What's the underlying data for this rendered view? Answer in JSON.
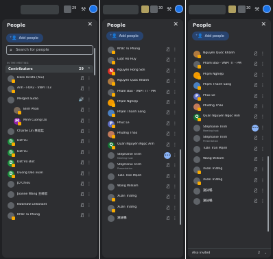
{
  "topbar": {
    "meeting_count": "29",
    "meeting_count_2": "30",
    "meeting_count_3": "30"
  },
  "panel": {
    "title": "People",
    "close_glyph": "✕",
    "add_label": "Add people",
    "add_icon": "person-add-icon",
    "search_placeholder": "Search for people",
    "in_meeting": "IN THE MEETING",
    "contributors": "Contributors",
    "contributors_count": "29",
    "also_invited": "Also invited",
    "also_invited_count": "2"
  },
  "glyphs": {
    "mic_off": "🎙̸",
    "more": "⋮",
    "collapse": "⌃",
    "expand": "⌄",
    "search": "⌕",
    "close": "✕"
  },
  "colors": {
    "accent": "#1a73e8",
    "badge": "#f9ab00",
    "panel": "#2d2e31"
  },
  "col1_rows": [
    {
      "name": "Daiki Hirata (You)",
      "color": "#5f6368",
      "badge": true,
      "mic": "🎙̸"
    },
    {
      "name": "Anh - FOP2 - VNPT IT3",
      "color": "#5f6368",
      "badge": true,
      "mic": "🎙̸"
    },
    {
      "name": "Merged audio",
      "color": "#5f6368",
      "badge": false,
      "mic": "🔊̸"
    },
    {
      "name": "Bình Phan",
      "color": "#7a6a5a",
      "badge": true,
      "mic": "🎙̸",
      "indent": true
    },
    {
      "name": "Minh Cuong Do",
      "color": "#8e24aa",
      "letter": "M",
      "badge": true,
      "mic": "🎙̸",
      "indent": true
    },
    {
      "name": "Charlie Lin 林延廷",
      "color": "#5f6368",
      "badge": false,
      "mic": "🎙̸"
    },
    {
      "name": "Dat Vu",
      "color": "#1e8e3e",
      "letter": "D",
      "badge": true,
      "mic": "🎙̸"
    },
    {
      "name": "Dat Vu",
      "color": "#1e8e3e",
      "letter": "D",
      "badge": true,
      "mic": "🎙̸"
    },
    {
      "name": "Dat Vũ Đức",
      "color": "#1e8e3e",
      "letter": "D",
      "badge": true,
      "mic": "🎙̸"
    },
    {
      "name": "Duong Dao xuan",
      "color": "#1e8e3e",
      "letter": "D",
      "badge": true,
      "mic": "🎙̸"
    },
    {
      "name": "JD Chiou",
      "color": "#5f6368",
      "badge": false,
      "mic": "🎙̸"
    },
    {
      "name": "Joanne Wang 王綺思",
      "color": "#5f6368",
      "badge": false,
      "mic": "🎙̸"
    },
    {
      "name": "Kwanlaw Lewanant",
      "color": "#5f6368",
      "badge": false,
      "mic": "🎙̸"
    },
    {
      "name": "Khắc Tú Phùng",
      "color": "#5f6368",
      "badge": true,
      "mic": "🎙̸"
    }
  ],
  "col2_rows": [
    {
      "name": "Khắc Tú Phùng",
      "color": "#5f6368",
      "badge": true
    },
    {
      "name": "Luật Hồ Huy",
      "color": "#5f6368",
      "badge": true
    },
    {
      "name": "Nguyễn Hồng Sơn",
      "color": "#d93025",
      "letter": "N",
      "badge": true
    },
    {
      "name": "Nguyễn Quốc Khánh",
      "color": "#b07a40",
      "badge": true
    },
    {
      "name": "Pham Bao - VNPT IT - PM",
      "color": "#5f6368",
      "badge": true
    },
    {
      "name": "Phạm Nghiệp",
      "color": "#f29900",
      "badge": true
    },
    {
      "name": "Phạm Thanh Sang",
      "color": "#4a7fc1",
      "badge": true
    },
    {
      "name": "Phuc Le",
      "color": "#5c6bc0",
      "letter": "P",
      "badge": true
    },
    {
      "name": "Phương Thảo",
      "color": "#c27a5a",
      "badge": true
    },
    {
      "name": "Quân Nguyễn Ngọc Anh",
      "color": "#137333",
      "letter": "Q",
      "badge": true
    },
    {
      "name": "Stephanie Trinh",
      "sub": "Meeting host",
      "color": "#5f6368",
      "badge": false,
      "talking": true
    },
    {
      "name": "Stephanie Trinh",
      "sub": "Presentation",
      "color": "#5f6368",
      "badge": false
    },
    {
      "name": "Tuấn Trần Mạnh",
      "color": "#5f6368",
      "badge": false
    },
    {
      "name": "Wang William",
      "color": "#5f6368",
      "badge": false
    },
    {
      "name": "Xuân Trường",
      "color": "#5f6368",
      "badge": true
    },
    {
      "name": "Xuân Trường",
      "color": "#5f6368",
      "badge": true
    },
    {
      "name": "謝詠暢",
      "color": "#5f6368",
      "badge": false
    }
  ],
  "col3_rows": [
    {
      "name": "Nguyễn Quốc Khánh",
      "color": "#b07a40",
      "badge": true
    },
    {
      "name": "Pham Bao - VNPT IT - PM",
      "color": "#5f6368",
      "badge": true
    },
    {
      "name": "Phạm Nghiệp",
      "color": "#f29900",
      "badge": true
    },
    {
      "name": "Phạm Thanh Sang",
      "color": "#4a7fc1",
      "badge": true
    },
    {
      "name": "Phuc Le",
      "color": "#5c6bc0",
      "letter": "P",
      "badge": true
    },
    {
      "name": "Phương Thảo",
      "color": "#c27a5a",
      "badge": true
    },
    {
      "name": "Quân Nguyễn Ngọc Anh",
      "color": "#137333",
      "letter": "Q",
      "badge": true
    },
    {
      "name": "Stephanie Trinh",
      "sub": "Meeting host",
      "color": "#5f6368",
      "badge": false,
      "talking": true
    },
    {
      "name": "Stephanie Trinh",
      "sub": "Presentation",
      "color": "#5f6368",
      "badge": false
    },
    {
      "name": "Tuấn Trần Mạnh",
      "color": "#5f6368",
      "badge": false
    },
    {
      "name": "Wang William",
      "color": "#5f6368",
      "badge": false
    },
    {
      "name": "Xuân Trường",
      "color": "#5f6368",
      "badge": true
    },
    {
      "name": "Xuân Trường",
      "color": "#5f6368",
      "badge": true
    },
    {
      "name": "謝詠暢",
      "color": "#5f6368",
      "badge": false
    },
    {
      "name": "謝詠暢",
      "color": "#5f6368",
      "badge": false
    }
  ]
}
